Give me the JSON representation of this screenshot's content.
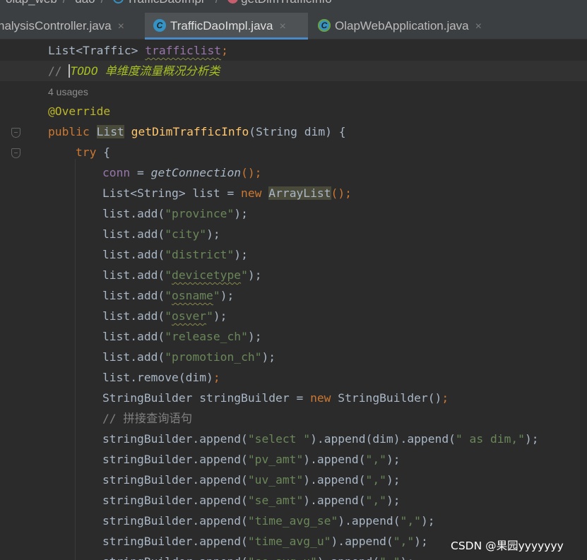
{
  "breadcrumb": {
    "items": [
      "olap_web",
      "dao",
      "TrafficDaoImpl",
      "getDimTrafficInfo"
    ],
    "separator": "/"
  },
  "tabs": [
    {
      "label": "nalysisController.java",
      "icon": "class-icon",
      "active": false
    },
    {
      "label": "TrafficDaoImpl.java",
      "icon": "class-icon",
      "active": true
    },
    {
      "label": "OlapWebApplication.java",
      "icon": "spring-boot-class-icon",
      "active": false
    }
  ],
  "close_glyph": "×",
  "code": {
    "field_decl": {
      "type": "List<Traffic> ",
      "name": "trafficlist",
      "end": ";"
    },
    "todo": {
      "slashes": "// ",
      "keyword": "TODO",
      "text": " 单维度流量概况分析类"
    },
    "usages": "4 usages",
    "annotation": "@Override",
    "method_sig": {
      "kw": "public ",
      "ret": "List",
      "name": "getDimTrafficInfo",
      "params": "(String dim) {"
    },
    "try": {
      "kw": "try",
      "rest": " {"
    },
    "conn": {
      "var": "conn",
      "op": " = ",
      "call": "getConnection",
      "end": "();"
    },
    "list_decl": {
      "type": "List<String> list = ",
      "kw": "new",
      "cls": "ArrayList",
      "end": "();"
    },
    "adds": [
      "province",
      "city",
      "district",
      "devicetype",
      "osname",
      "osver",
      "release_ch",
      "promotion_ch"
    ],
    "add_prefix": "list.add(",
    "add_suffix": ");",
    "remove": {
      "call": "list.remove(dim)",
      "end": ";"
    },
    "sb_decl": {
      "type": "StringBuilder stringBuilder = ",
      "kw": "new",
      "cls": " StringBuilder()",
      "end": ";"
    },
    "comment2": "// 拼接查询语句",
    "appends": [
      {
        "pre": "stringBuilder.append(",
        "s1": "\"select \"",
        "mid": ").append(dim).append(",
        "s2": "\" as dim,\"",
        "end": ");"
      },
      {
        "pre": "stringBuilder.append(",
        "s1": "\"pv_amt\"",
        "mid": ").append(",
        "s2": "\",\"",
        "end": ");"
      },
      {
        "pre": "stringBuilder.append(",
        "s1": "\"uv_amt\"",
        "mid": ").append(",
        "s2": "\",\"",
        "end": ");"
      },
      {
        "pre": "stringBuilder.append(",
        "s1": "\"se_amt\"",
        "mid": ").append(",
        "s2": "\",\"",
        "end": ");"
      },
      {
        "pre": "stringBuilder.append(",
        "s1": "\"time_avg_se\"",
        "mid": ").append(",
        "s2": "\",\"",
        "end": ");"
      },
      {
        "pre": "stringBuilder.append(",
        "s1": "\"time_avg_u\"",
        "mid": ").append(",
        "s2": "\",\"",
        "end": ");"
      },
      {
        "pre": "stringBuilder.append(",
        "s1": "\"se_avg_u\"",
        "mid": ").append(",
        "s2": "\",\"",
        "end": ");"
      }
    ]
  },
  "watermark": "CSDN @果园yyyyyyy",
  "colors": {
    "editor_bg": "#2b2b2b",
    "tabbar_bg": "#3c3f41",
    "keyword": "#cc7832",
    "field": "#9876aa",
    "string": "#6a8759",
    "method": "#ffc66d",
    "annotation": "#bbb529",
    "todo": "#a8c023",
    "comment": "#808080",
    "active_tab_underline": "#4a88c7"
  }
}
